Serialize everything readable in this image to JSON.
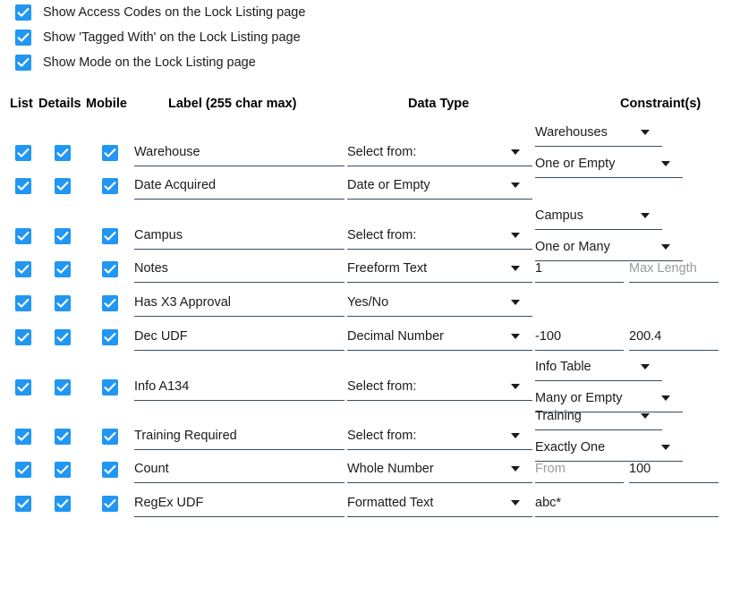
{
  "options": [
    {
      "label": "Show Access Codes on the Lock Listing page",
      "checked": true
    },
    {
      "label": "Show 'Tagged With' on the Lock Listing page",
      "checked": true
    },
    {
      "label": "Show Mode on the Lock Listing page",
      "checked": true
    }
  ],
  "table": {
    "headers": {
      "list": "List",
      "details": "Details",
      "mobile": "Mobile",
      "label": "Label (255 char max)",
      "data_type": "Data Type",
      "constraints": "Constraint(s)"
    },
    "rows": [
      {
        "list": true,
        "details": true,
        "mobile": true,
        "label": "Warehouse",
        "data_type": "Select from:",
        "constraint_1": "Warehouses",
        "constraint_2": "One or Empty"
      },
      {
        "list": true,
        "details": true,
        "mobile": true,
        "label": "Date Acquired",
        "data_type": "Date or Empty"
      },
      {
        "list": true,
        "details": true,
        "mobile": true,
        "label": "Campus",
        "data_type": "Select from:",
        "constraint_1": "Campus",
        "constraint_2": "One or Many"
      },
      {
        "list": true,
        "details": true,
        "mobile": true,
        "label": "Notes",
        "data_type": "Freeform Text",
        "num_1_value": "1",
        "num_2_value": "",
        "num_2_placeholder": "Max Length"
      },
      {
        "list": true,
        "details": true,
        "mobile": true,
        "label": "Has X3 Approval",
        "data_type": "Yes/No"
      },
      {
        "list": true,
        "details": true,
        "mobile": true,
        "label": "Dec UDF",
        "data_type": "Decimal Number",
        "num_1_value": "-100",
        "num_2_value": "200.4"
      },
      {
        "list": true,
        "details": true,
        "mobile": true,
        "label": "Info A134",
        "data_type": "Select from:",
        "constraint_1": "Info Table",
        "constraint_2": "Many or Empty"
      },
      {
        "list": true,
        "details": true,
        "mobile": true,
        "label": "Training Required",
        "data_type": "Select from:",
        "constraint_1": "Training",
        "constraint_2": "Exactly One"
      },
      {
        "list": true,
        "details": true,
        "mobile": true,
        "label": "Count",
        "data_type": "Whole Number",
        "num_1_value": "",
        "num_1_placeholder": "From",
        "num_2_value": "100"
      },
      {
        "list": true,
        "details": true,
        "mobile": true,
        "label": "RegEx UDF",
        "data_type": "Formatted Text",
        "wide_value": "abc*"
      }
    ]
  },
  "colors": {
    "checkbox": "#2196f3",
    "underline": "#3b4a63",
    "text": "#1b1b1b",
    "placeholder": "#9b9b9b"
  }
}
